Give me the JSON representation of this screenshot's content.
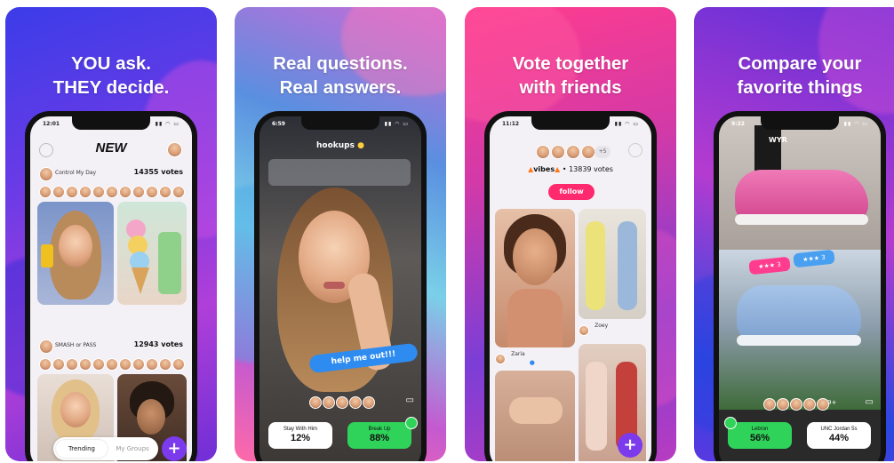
{
  "panels": [
    {
      "headline_line1": "YOU ask.",
      "headline_line2": "THEY decide."
    },
    {
      "headline_line1": "Real questions.",
      "headline_line2": "Real answers."
    },
    {
      "headline_line1": "Vote together",
      "headline_line2": "with friends"
    },
    {
      "headline_line1": "Compare your",
      "headline_line2": "favorite things"
    }
  ],
  "screen1": {
    "time": "12:01",
    "logo": "NEW",
    "post1": {
      "author": "Control My Day",
      "votes": "14355 votes"
    },
    "post2": {
      "author": "SMASH or PASS",
      "votes": "12943 votes"
    },
    "tabs": {
      "trending": "Trending",
      "groups": "My Groups"
    },
    "fab": "+"
  },
  "screen2": {
    "time": "6:59",
    "title": "hookups",
    "caption": "help me out!!!",
    "options": [
      {
        "label": "Stay With Him",
        "percent": "12%"
      },
      {
        "label": "Break Up",
        "percent": "88%"
      }
    ]
  },
  "screen3": {
    "time": "11:12",
    "count": "+5",
    "group": "vibes",
    "votes": "13839 votes",
    "follow": "follow",
    "users": [
      "Zoey",
      "Zaria"
    ],
    "fab": "+"
  },
  "screen4": {
    "time": "9:22",
    "brand": "WYR",
    "rating_a": "3",
    "rating_b": "3",
    "voters": "9+",
    "options": [
      {
        "label": "Lebron",
        "percent": "56%"
      },
      {
        "label": "UNC Jordan 5s",
        "percent": "44%"
      }
    ]
  }
}
